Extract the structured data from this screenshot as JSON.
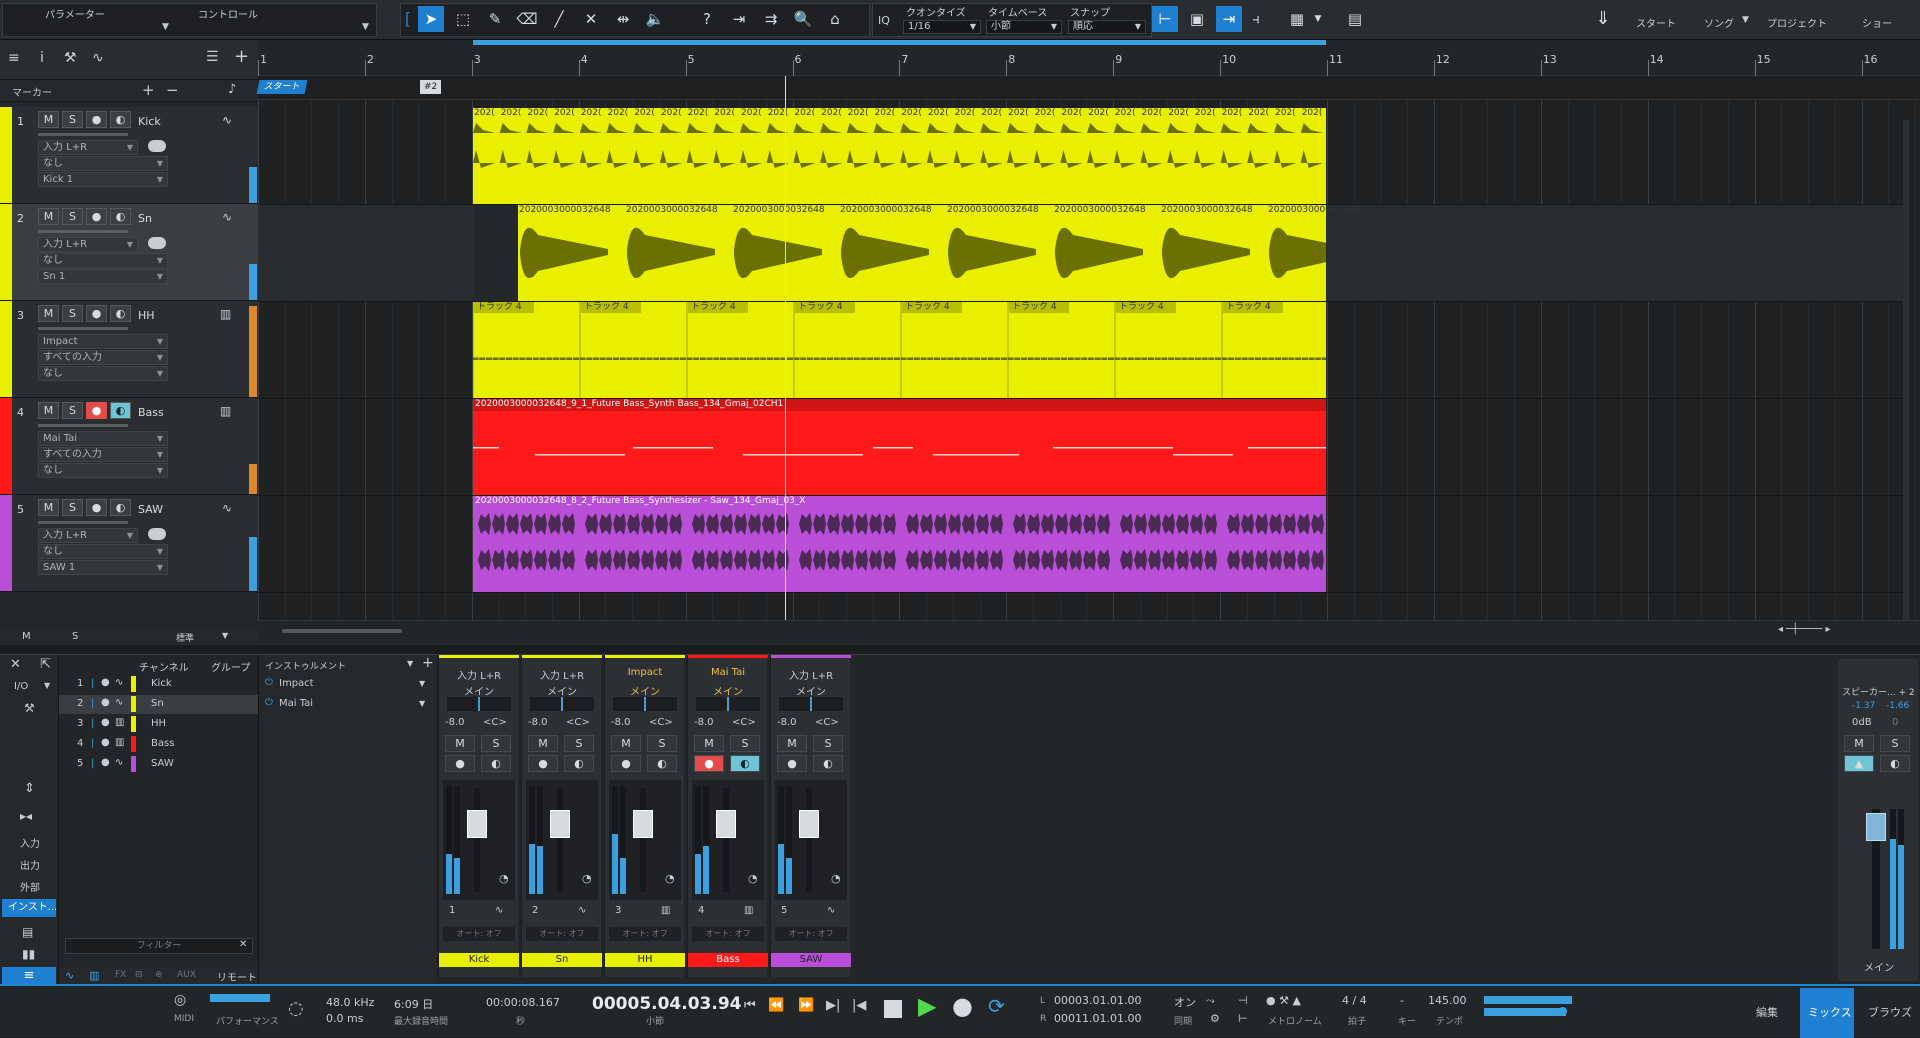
{
  "toolbar": {
    "params": "パラメーター",
    "control": "コントロール",
    "quantize_label": "クオンタイズ",
    "quantize_value": "1/16",
    "timebase_label": "タイムベース",
    "timebase_value": "小節",
    "snap_label": "スナップ",
    "snap_value": "順応",
    "iq": "IQ",
    "start": "スタート",
    "song": "ソング",
    "project": "プロジェクト",
    "show": "ショー"
  },
  "marker": {
    "label": "マーカー",
    "start_flag": "スタート",
    "marker2": "#2"
  },
  "ruler": [
    "1",
    "2",
    "3",
    "4",
    "5",
    "6",
    "7",
    "8",
    "9",
    "10",
    "11",
    "12",
    "13",
    "14",
    "15",
    "16"
  ],
  "tracks": [
    {
      "num": "1",
      "name": "Kick",
      "color": "#e8f000",
      "dd": [
        "入力 L+R",
        "なし",
        "Kick 1"
      ],
      "rec": false
    },
    {
      "num": "2",
      "name": "Sn",
      "color": "#e8f000",
      "dd": [
        "入力 L+R",
        "なし",
        "Sn 1"
      ],
      "rec": false
    },
    {
      "num": "3",
      "name": "HH",
      "color": "#e8f000",
      "dd": [
        "Impact",
        "すべての入力",
        "なし"
      ],
      "rec": false
    },
    {
      "num": "4",
      "name": "Bass",
      "color": "#ff1a1a",
      "dd": [
        "Mai Tai",
        "すべての入力",
        "なし"
      ],
      "rec": true
    },
    {
      "num": "5",
      "name": "SAW",
      "color": "#b84fd6",
      "dd": [
        "入力 L+R",
        "なし",
        "SAW 1"
      ],
      "rec": false
    }
  ],
  "track_buttons": {
    "m": "M",
    "s": "S"
  },
  "clips": {
    "kick_title": "202(",
    "sn_title": "2020003000032648",
    "hh_title": "トラック 4",
    "bass_title": "2020003000032648_9_1_Future Bass_Synth Bass_134_Gmaj_02CH1",
    "saw_title": "2020003000032648_8_2_Future Bass_Synthesizer - Saw_134_Gmaj_03_X"
  },
  "footer": {
    "m": "M",
    "s": "S",
    "std": "標準"
  },
  "mixer": {
    "tabs": [
      "チャンネル",
      "グループ"
    ],
    "instruments_label": "インストゥルメント",
    "instruments": [
      "Impact",
      "Mai Tai"
    ],
    "io": "I/O",
    "side": [
      "入力",
      "出力",
      "外部",
      "インスト..."
    ],
    "filter": "フィルター",
    "remote": "リモート",
    "fx": "FX",
    "aux": "AUX",
    "channels": [
      {
        "num": "1",
        "name": "Kick"
      },
      {
        "num": "2",
        "name": "Sn"
      },
      {
        "num": "3",
        "name": "HH"
      },
      {
        "num": "4",
        "name": "Bass"
      },
      {
        "num": "5",
        "name": "SAW"
      }
    ],
    "strips": [
      {
        "in": "入力 L+R",
        "out": "メイン",
        "vol": "-8.0",
        "pan": "<C>",
        "num": "1",
        "name": "Kick",
        "color": "#e8f000",
        "auto": "オート: オフ"
      },
      {
        "in": "入力 L+R",
        "out": "メイン",
        "vol": "-8.0",
        "pan": "<C>",
        "num": "2",
        "name": "Sn",
        "color": "#e8f000",
        "auto": "オート: オフ"
      },
      {
        "in": "Impact",
        "out": "メイン",
        "vol": "-8.0",
        "pan": "<C>",
        "num": "3",
        "name": "HH",
        "color": "#e8f000",
        "auto": "オート: オフ"
      },
      {
        "in": "Mai Tai",
        "out": "メイン",
        "vol": "-8.0",
        "pan": "<C>",
        "num": "4",
        "name": "Bass",
        "color": "#ff1a1a",
        "auto": "オート: オフ"
      },
      {
        "in": "入力 L+R",
        "out": "メイン",
        "vol": "-8.0",
        "pan": "<C>",
        "num": "5",
        "name": "SAW",
        "color": "#b84fd6",
        "auto": "オート: オフ"
      }
    ],
    "master": {
      "out": "スピーカー... + 2",
      "l": "-1.37",
      "r": "-1.66",
      "db": "0dB",
      "zero": "0",
      "name": "メイン"
    }
  },
  "transport": {
    "midi": "MIDI",
    "performance": "パフォーマンス",
    "samplerate": "48.0 kHz",
    "latency": "0.0 ms",
    "maxrec": "6:09 日",
    "maxrec_label": "最大録音時間",
    "seconds": "00:00:08.167",
    "sec_label": "秒",
    "bars": "00005.04.03.94",
    "bars_label": "小節",
    "loop_l": "00003.01.01.00",
    "loop_r": "00011.01.01.00",
    "sync": "オン",
    "sync_label": "同期",
    "metronome": "メトロノーム",
    "timesig": "4 / 4",
    "timesig_label": "拍子",
    "key": "-",
    "key_label": "キー",
    "tempo": "145.00",
    "tempo_label": "テンポ",
    "edit": "編集",
    "mix": "ミックス",
    "browse": "ブラウズ",
    "l": "L",
    "r": "R"
  }
}
